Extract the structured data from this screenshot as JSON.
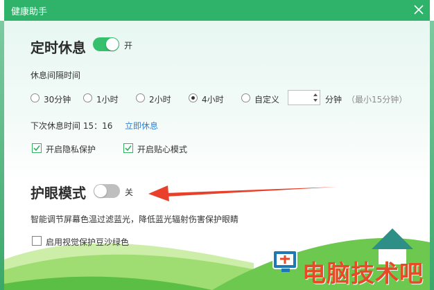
{
  "window": {
    "title": "健康助手"
  },
  "rest": {
    "heading": "定时休息",
    "toggle_state": "开",
    "interval_label": "休息间隔时间",
    "options": [
      "30分钟",
      "1小时",
      "2小时",
      "4小时",
      "自定义"
    ],
    "selected_option": "4小时",
    "custom_value": "",
    "unit": "分钟",
    "hint": "（最小15分钟）",
    "next_label": "下次休息时间 15：16",
    "rest_now_link": "立即休息",
    "privacy_label": "开启隐私保护",
    "privacy_checked": true,
    "care_label": "开启贴心模式",
    "care_checked": true
  },
  "eye": {
    "heading": "护眼模式",
    "toggle_state": "关",
    "description": "智能调节屏幕色温过滤蓝光，降低蓝光辐射伤害保护眼睛",
    "green_label": "启用视觉保护豆沙绿色",
    "green_checked": false
  },
  "watermark": {
    "text": "电脑技术吧"
  },
  "colors": {
    "titlebar": "#2fb36a",
    "toggle_on": "#36c06d",
    "link": "#2f7fd6",
    "annotation_arrow": "#e8402a",
    "watermark": "#e84a25"
  },
  "icons": {
    "close": "close-icon",
    "check": "checkmark-icon",
    "arrow": "red-annotation-arrow",
    "logo": "house-computer-logo-icon"
  }
}
